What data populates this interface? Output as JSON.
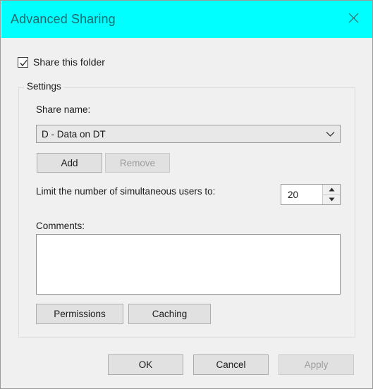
{
  "window": {
    "title": "Advanced Sharing",
    "close_icon": "close-icon",
    "titlebar_color": "#00ffff",
    "title_text_color": "#1d6b6b",
    "background_color": "#f0f0f0"
  },
  "share_folder": {
    "label": "Share this folder",
    "checked": true,
    "check_icon": "check-icon"
  },
  "settings": {
    "legend": "Settings",
    "share_name": {
      "label": "Share name:",
      "value": "D - Data on DT",
      "dropdown_icon": "chevron-down-icon"
    },
    "add_label": "Add",
    "add_enabled": true,
    "remove_label": "Remove",
    "remove_enabled": false,
    "limit": {
      "label": "Limit the number of simultaneous users to:",
      "value": "20",
      "up_icon": "triangle-up-icon",
      "down_icon": "triangle-down-icon"
    },
    "comments": {
      "label": "Comments:",
      "value": "",
      "placeholder": ""
    },
    "permissions_label": "Permissions",
    "permissions_enabled": true,
    "caching_label": "Caching",
    "caching_enabled": true
  },
  "footer": {
    "ok_label": "OK",
    "ok_enabled": true,
    "cancel_label": "Cancel",
    "cancel_enabled": true,
    "apply_label": "Apply",
    "apply_enabled": false
  }
}
